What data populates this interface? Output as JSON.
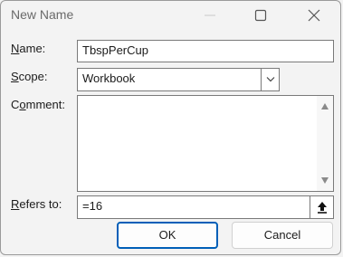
{
  "window": {
    "title": "New Name"
  },
  "titlebar_buttons": {
    "minimize_icon": "minimize-icon",
    "maximize_icon": "maximize-icon",
    "close_icon": "close-icon"
  },
  "form": {
    "name": {
      "label_prefix": "",
      "label_access": "N",
      "label_rest": "ame:",
      "value": "TbspPerCup"
    },
    "scope": {
      "label_prefix": "",
      "label_access": "S",
      "label_rest": "cope:",
      "value": "Workbook"
    },
    "comment": {
      "label_prefix": "C",
      "label_access": "o",
      "label_rest": "mment:",
      "value": ""
    },
    "refers_to": {
      "label_prefix": "",
      "label_access": "R",
      "label_rest": "efers to:",
      "value": "=16"
    }
  },
  "buttons": {
    "ok": "OK",
    "cancel": "Cancel"
  },
  "colors": {
    "accent": "#005fb8",
    "background": "#f3f3f3",
    "field_border": "#7a7a7a"
  }
}
